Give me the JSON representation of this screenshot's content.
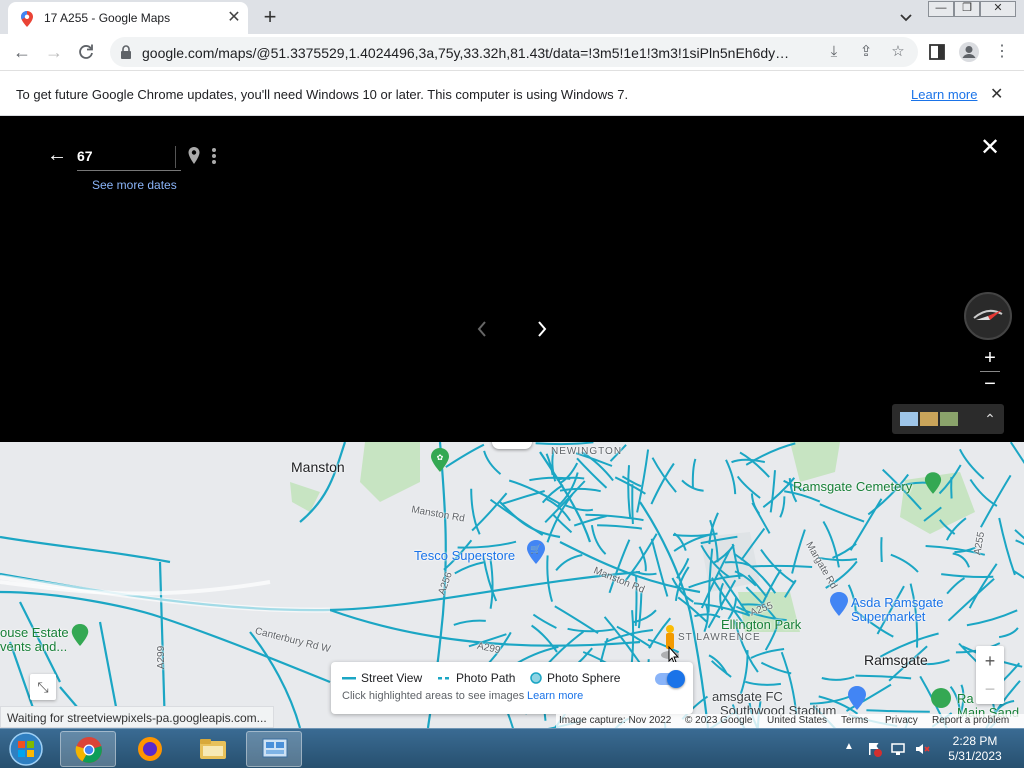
{
  "window": {
    "tab_title": "17 A255 - Google Maps",
    "new_tab": "+",
    "minimize": "—",
    "maximize": "❐",
    "close": "✕"
  },
  "toolbar": {
    "url": "google.com/maps/@51.3375529,1.4024496,3a,75y,33.32h,81.43t/data=!3m5!1e1!3m3!1siPln5nEh6dyXjGS9s..."
  },
  "infobar": {
    "message": "To get future Google Chrome updates, you'll need Windows 10 or later. This computer is using Windows 7.",
    "learn_more": "Learn more"
  },
  "streetview": {
    "title": "67",
    "see_more_dates": "See more dates"
  },
  "map": {
    "labels": {
      "manston": "Manston",
      "newington": "NEWINGTON",
      "ramsgate_cemetery": "Ramsgate Cemetery",
      "manston_rd_1": "Manston Rd",
      "tesco": "Tesco Superstore",
      "manston_rd_2": "Manston Rd",
      "a256": "A256",
      "margate_rd": "Margate Rd",
      "a255_north": "A255",
      "a255": "A255",
      "asda_1": "Asda Ramsgate",
      "asda_2": "Supermarket",
      "ellington_park": "Ellington Park",
      "st_lawrence": "ST LAWRENCE",
      "estate_1": "ouse Estate",
      "estate_2": "vents and...",
      "canterbury_rd": "Canterbury Rd W",
      "a299_left": "A299",
      "a299": "A299",
      "ramsgate": "Ramsgate",
      "ramsgate_fc": "amsgate FC",
      "southwood": "Southwood Stadium",
      "main_sand_1": "Ra",
      "main_sand_2": "Main Sand"
    },
    "legend": {
      "street_view": "Street View",
      "photo_path": "Photo Path",
      "photo_sphere": "Photo Sphere",
      "hint": "Click highlighted areas to see images",
      "learn_more": "Learn more"
    },
    "attribution": {
      "capture": "Image capture: Nov 2022",
      "copyright": "© 2023 Google",
      "region": "United States",
      "terms": "Terms",
      "privacy": "Privacy",
      "report": "Report a problem"
    },
    "zoom_in": "+",
    "zoom_out": "−"
  },
  "status": "Waiting for streetviewpixels-pa.googleapis.com...",
  "taskbar": {
    "time": "2:28 PM",
    "date": "5/31/2023"
  },
  "colors": {
    "coverage": "#1ba6c4",
    "link": "#1a73e8",
    "park": "#c7e4c2"
  }
}
